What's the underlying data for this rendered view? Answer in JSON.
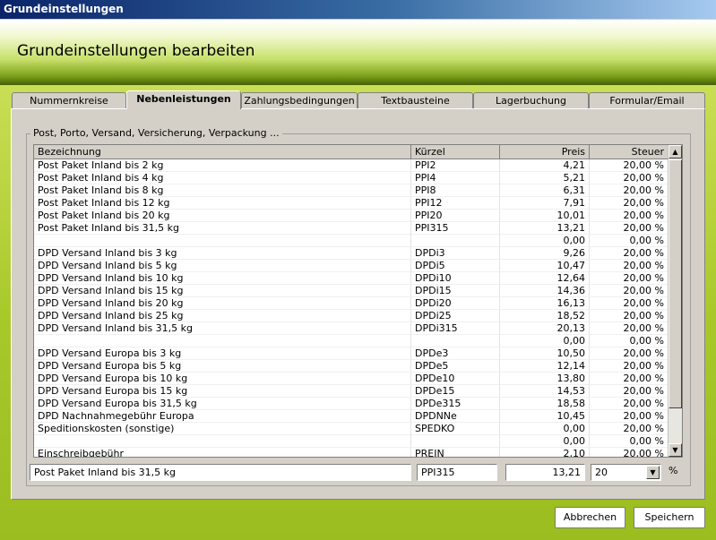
{
  "window": {
    "title": "Grundeinstellungen"
  },
  "header": {
    "title": "Grundeinstellungen bearbeiten"
  },
  "tabs": [
    {
      "label": "Nummernkreise"
    },
    {
      "label": "Nebenleistungen"
    },
    {
      "label": "Zahlungsbedingungen"
    },
    {
      "label": "Textbausteine"
    },
    {
      "label": "Lagerbuchung"
    },
    {
      "label": "Formular/Email"
    }
  ],
  "active_tab": "Nebenleistungen",
  "group": {
    "legend": "Post, Porto, Versand, Versicherung, Verpackung ..."
  },
  "grid": {
    "columns": {
      "bezeichnung": "Bezeichnung",
      "kuerzel": "Kürzel",
      "preis": "Preis",
      "steuer": "Steuer"
    },
    "rows": [
      {
        "bez": "Post Paket Inland bis 2 kg",
        "kur": "PPI2",
        "preis": "4,21",
        "steuer": "20,00 %"
      },
      {
        "bez": "Post Paket Inland bis 4 kg",
        "kur": "PPI4",
        "preis": "5,21",
        "steuer": "20,00 %"
      },
      {
        "bez": "Post Paket Inland bis 8 kg",
        "kur": "PPI8",
        "preis": "6,31",
        "steuer": "20,00 %"
      },
      {
        "bez": "Post Paket Inland bis 12 kg",
        "kur": "PPI12",
        "preis": "7,91",
        "steuer": "20,00 %"
      },
      {
        "bez": "Post Paket Inland bis 20 kg",
        "kur": "PPI20",
        "preis": "10,01",
        "steuer": "20,00 %"
      },
      {
        "bez": "Post Paket Inland bis 31,5 kg",
        "kur": "PPI315",
        "preis": "13,21",
        "steuer": "20,00 %"
      },
      {
        "bez": "",
        "kur": "",
        "preis": "0,00",
        "steuer": "0,00 %"
      },
      {
        "bez": "DPD Versand Inland bis 3 kg",
        "kur": "DPDi3",
        "preis": "9,26",
        "steuer": "20,00 %"
      },
      {
        "bez": "DPD Versand Inland bis 5 kg",
        "kur": "DPDi5",
        "preis": "10,47",
        "steuer": "20,00 %"
      },
      {
        "bez": "DPD Versand Inland bis 10 kg",
        "kur": "DPDi10",
        "preis": "12,64",
        "steuer": "20,00 %"
      },
      {
        "bez": "DPD Versand Inland bis 15 kg",
        "kur": "DPDi15",
        "preis": "14,36",
        "steuer": "20,00 %"
      },
      {
        "bez": "DPD Versand Inland bis 20 kg",
        "kur": "DPDi20",
        "preis": "16,13",
        "steuer": "20,00 %"
      },
      {
        "bez": "DPD Versand Inland bis 25 kg",
        "kur": "DPDi25",
        "preis": "18,52",
        "steuer": "20,00 %"
      },
      {
        "bez": "DPD Versand Inland bis 31,5 kg",
        "kur": "DPDi315",
        "preis": "20,13",
        "steuer": "20,00 %"
      },
      {
        "bez": "",
        "kur": "",
        "preis": "0,00",
        "steuer": "0,00 %"
      },
      {
        "bez": "DPD Versand Europa bis 3 kg",
        "kur": "DPDe3",
        "preis": "10,50",
        "steuer": "20,00 %"
      },
      {
        "bez": "DPD Versand Europa bis 5 kg",
        "kur": "DPDe5",
        "preis": "12,14",
        "steuer": "20,00 %"
      },
      {
        "bez": "DPD Versand Europa bis 10 kg",
        "kur": "DPDe10",
        "preis": "13,80",
        "steuer": "20,00 %"
      },
      {
        "bez": "DPD Versand Europa bis 15 kg",
        "kur": "DPDe15",
        "preis": "14,53",
        "steuer": "20,00 %"
      },
      {
        "bez": "DPD Versand Europa bis 31,5 kg",
        "kur": "DPDe315",
        "preis": "18,58",
        "steuer": "20,00 %"
      },
      {
        "bez": "DPD Nachnahmegebühr Europa",
        "kur": "DPDNNe",
        "preis": "10,45",
        "steuer": "20,00 %"
      },
      {
        "bez": "Speditionskosten (sonstige)",
        "kur": "SPEDKO",
        "preis": "0,00",
        "steuer": "20,00 %"
      },
      {
        "bez": "",
        "kur": "",
        "preis": "0,00",
        "steuer": "0,00 %"
      },
      {
        "bez": "Einschreibgebühr",
        "kur": "PREIN",
        "preis": "2,10",
        "steuer": "20,00 %"
      }
    ]
  },
  "editor": {
    "bezeichnung": "Post Paket Inland bis 31,5 kg",
    "kuerzel": "PPI315",
    "preis": "13,21",
    "steuer": "20",
    "percent_label": "%"
  },
  "buttons": {
    "cancel": "Abbrechen",
    "save": "Speichern"
  },
  "icons": {
    "scroll_up": "up-arrow-icon",
    "scroll_down": "down-arrow-icon",
    "dropdown": "chevron-down-icon"
  },
  "colors": {
    "header_green": "#7da11a",
    "background_green": "#a9c92b",
    "titlebar": "#0a246a"
  }
}
